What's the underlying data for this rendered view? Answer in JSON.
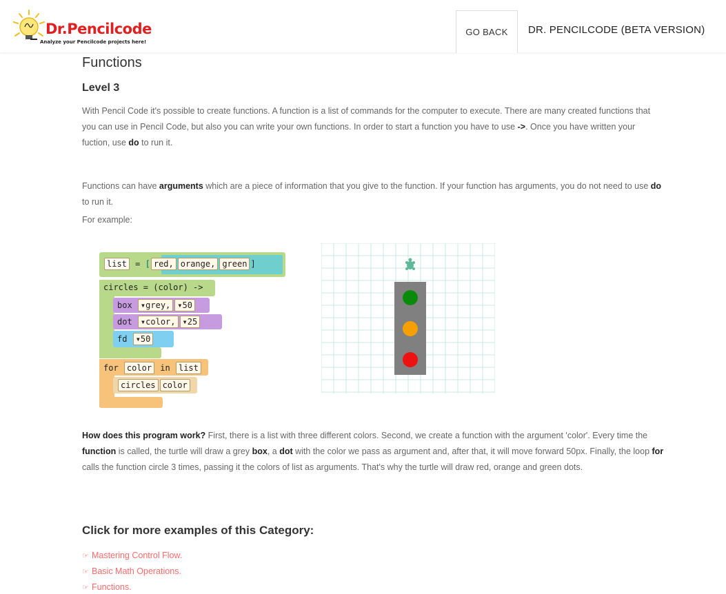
{
  "header": {
    "logo_title": "Dr.Pencilcode",
    "logo_subtitle": "Analyze your Pencilcode projects here!",
    "go_back_label": "GO BACK",
    "brand_version": "DR. PENCILCODE (BETA VERSION)"
  },
  "main": {
    "section_title": "Functions",
    "level": "Level 3",
    "intro": {
      "t1": "With Pencil Code it's possible to create functions. A function is a list of commands for the computer to execute. There are many created functions that you can use in Pencil Code, but also you can write your own functions. In order to start a function you have to use ",
      "arrow": "->",
      "t2": ". Once you have written your fuction, use ",
      "do": "do",
      "t3": " to run it."
    },
    "args_para": {
      "t1": "Functions can have ",
      "arguments": "arguments",
      "t2": " which are a piece of information that you give to the function. If your function has arguments, you do not need to use ",
      "do": "do",
      "t3": " to run it."
    },
    "for_example": "For example:",
    "code": {
      "line1_kw": "list",
      "line1_eq": "=",
      "list_open": "[",
      "list_items": [
        "red,",
        "orange,",
        "green"
      ],
      "list_close": "]",
      "line2": "circles = (color) ->",
      "box_kw": "box",
      "box_arg1": "▾grey,",
      "box_arg2": "▾50",
      "dot_kw": "dot",
      "dot_arg1": "▾color,",
      "dot_arg2": "▾25",
      "fd_kw": "fd",
      "fd_arg": "▾50",
      "for_kw": "for",
      "for_var": "color",
      "in_kw": "in",
      "for_list": "list",
      "call_fn": "circles",
      "call_arg": "color"
    },
    "output": {
      "dot_colors": [
        "#0a8a0a",
        "#f5a000",
        "#ee1111"
      ],
      "box_color": "#808080",
      "turtle_color": "#5fb89a"
    },
    "how": {
      "q": "How does this program work?",
      "t1": " First, there is a list with three different colors. Second, we create a function with the argument 'color'. Every time the ",
      "function": "function",
      "t2": " is called, the turtle will draw a grey ",
      "box": "box",
      "t3": ", a ",
      "dot": "dot",
      "t4": " with the color we pass as argument and, after that, it will move forward 50px. Finally, the loop ",
      "for": "for",
      "t5": " calls the function circle 3 times, passing it the colors of list as arguments. That's why the turtle will draw red, orange and green dots."
    },
    "more_title": "Click for more examples of this Category:",
    "links": [
      "Mastering Control Flow.",
      "Basic Math Operations.",
      "Functions."
    ]
  },
  "colors": {
    "accent_link": "#ff6b6b",
    "logo_red": "#e02020",
    "block_green": "#b8d88a",
    "block_purple": "#c79be0",
    "block_blue": "#7fd0f0",
    "block_orange": "#f7c27a",
    "block_teal": "#6fcfcf"
  }
}
